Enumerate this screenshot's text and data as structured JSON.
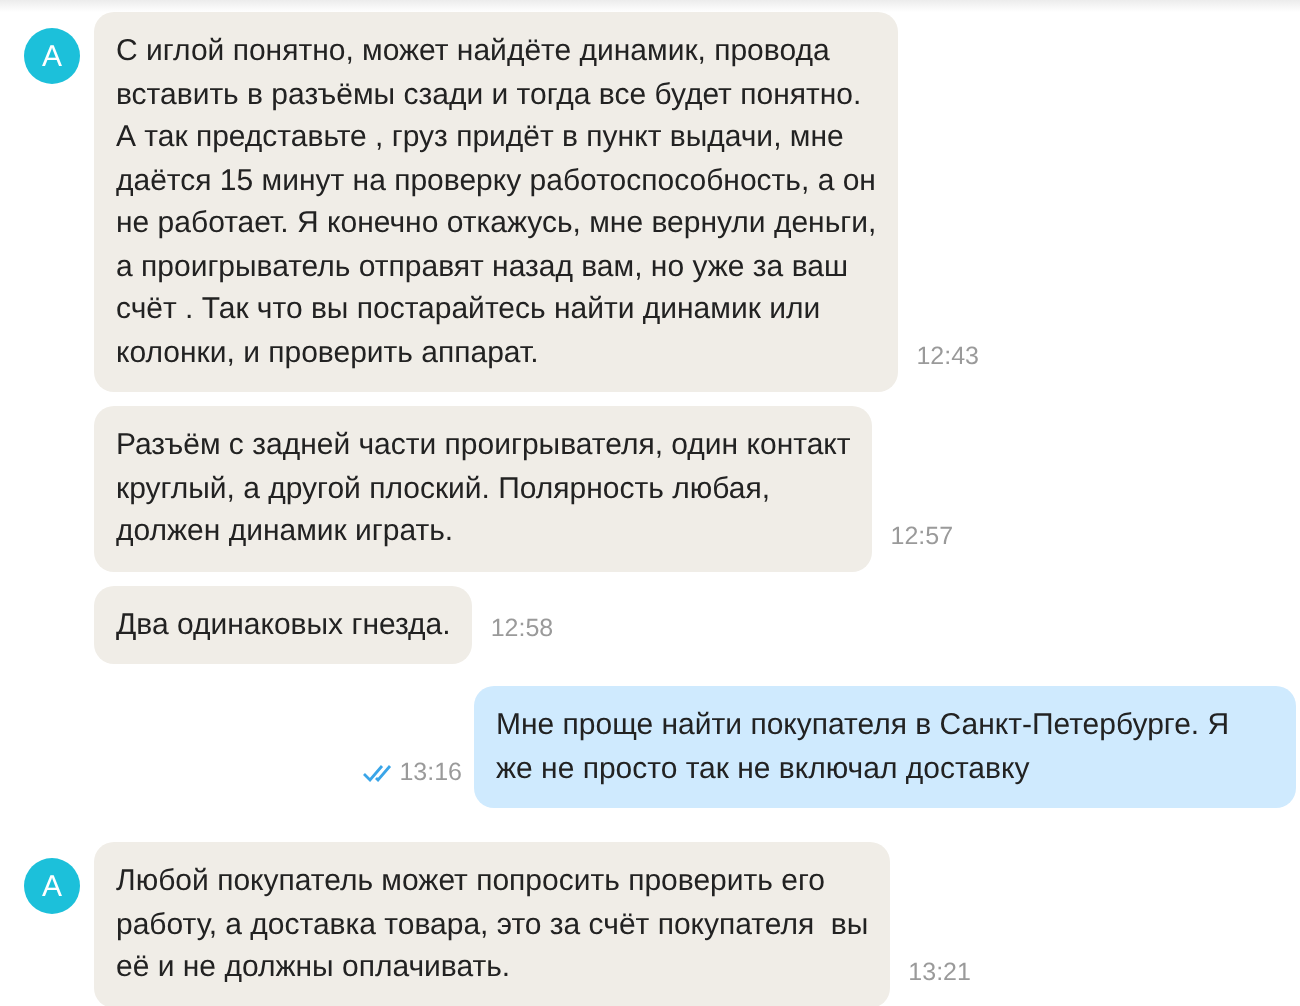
{
  "messages": [
    {
      "outgoing": false,
      "avatar": "А",
      "text": "С иглой понятно, может найдёте динамик, провода\nвставить в разъёмы сзади и тогда все будет понятно.\nА так представьте , груз придёт в пункт выдачи, мне\nдаётся 15 минут на проверку работоспособность, а он\nне работает. Я конечно откажусь, мне вернули деньги,\nа проигрыватель отправят назад вам, но уже за ваш\nсчёт . Так что вы постарайтесь найти динамик или\nколонки, и проверить аппарат.",
      "time": "12:43"
    },
    {
      "outgoing": false,
      "text": "Разъём с задней части проигрывателя, один контакт\nкруглый, а другой плоский. Полярность любая,\nдолжен динамик играть.",
      "time": "12:57"
    },
    {
      "outgoing": false,
      "text": "Два одинаковых гнезда.",
      "time": "12:58"
    },
    {
      "outgoing": true,
      "read": true,
      "text": "Мне проще найти покупателя в Санкт-Петербурге. Я\nже не просто так не включал доставку",
      "time": "13:16"
    },
    {
      "outgoing": false,
      "avatar": "А",
      "text": "Любой покупатель может попросить проверить его\nработу, а доставка товара, это за счёт покупателя  вы\nеё и не должны оплачивать.",
      "time": "13:21"
    }
  ]
}
